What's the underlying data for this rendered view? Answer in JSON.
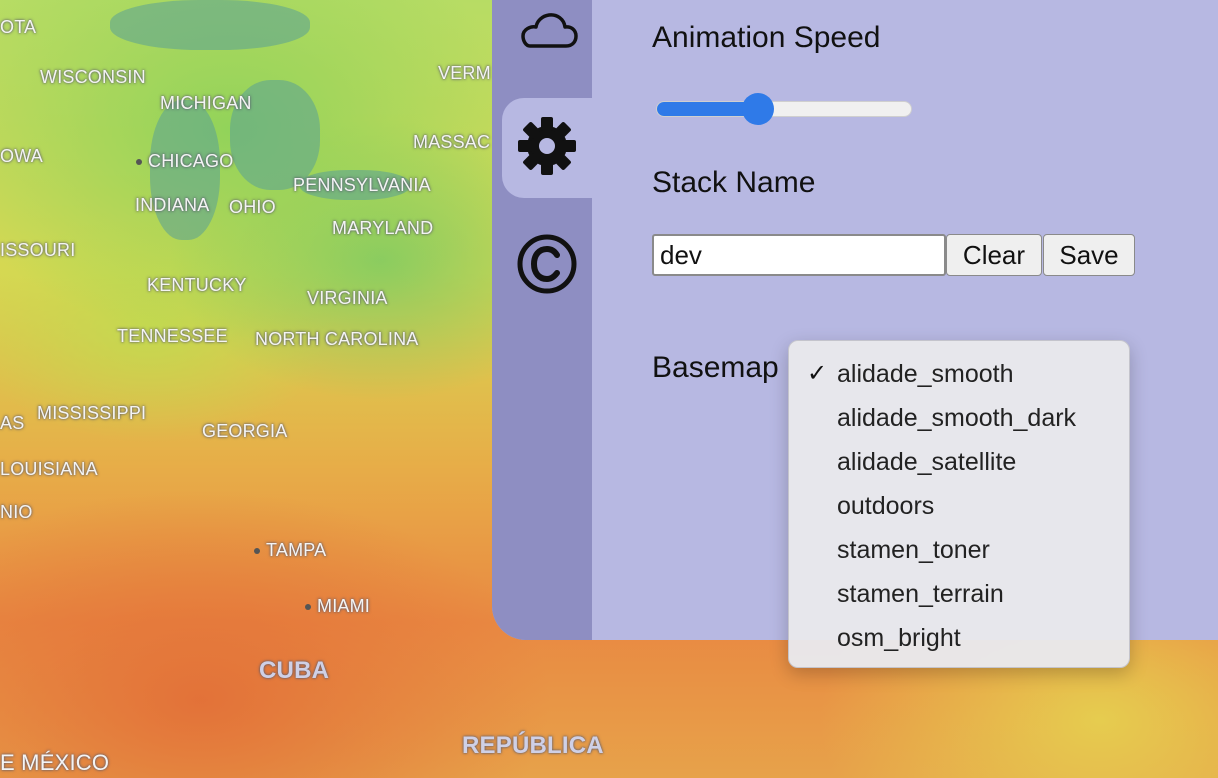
{
  "map": {
    "labels": [
      {
        "text": "OTA",
        "type": "region"
      },
      {
        "text": "WISCONSIN",
        "type": "region"
      },
      {
        "text": "VERM",
        "type": "region"
      },
      {
        "text": "MICHIGAN",
        "type": "region"
      },
      {
        "text": "OWA",
        "type": "region"
      },
      {
        "text": "CHICAGO",
        "type": "city"
      },
      {
        "text": "MASSAC",
        "type": "region"
      },
      {
        "text": "PENNSYLVANIA",
        "type": "region"
      },
      {
        "text": "INDIANA",
        "type": "region"
      },
      {
        "text": "OHIO",
        "type": "region"
      },
      {
        "text": "MARYLAND",
        "type": "region"
      },
      {
        "text": "ISSOURI",
        "type": "region"
      },
      {
        "text": "KENTUCKY",
        "type": "region"
      },
      {
        "text": "VIRGINIA",
        "type": "region"
      },
      {
        "text": "TENNESSEE",
        "type": "region"
      },
      {
        "text": "NORTH CAROLINA",
        "type": "region"
      },
      {
        "text": "AS",
        "type": "region"
      },
      {
        "text": "MISSISSIPPI",
        "type": "region"
      },
      {
        "text": "GEORGIA",
        "type": "region"
      },
      {
        "text": "LOUISIANA",
        "type": "region"
      },
      {
        "text": "NIO",
        "type": "region"
      },
      {
        "text": "TAMPA",
        "type": "city"
      },
      {
        "text": "MIAMI",
        "type": "city"
      },
      {
        "text": "CUBA",
        "type": "country"
      },
      {
        "text": "REPÚBLICA",
        "type": "country"
      },
      {
        "text": "E MÉXICO",
        "type": "region"
      }
    ]
  },
  "sidebar": {
    "tabs": [
      {
        "icon": "cloud-icon",
        "active": false
      },
      {
        "icon": "gear-icon",
        "active": true
      },
      {
        "icon": "copyright-icon",
        "active": false
      }
    ]
  },
  "settings": {
    "animation_speed_label": "Animation Speed",
    "animation_speed_value": 0.4,
    "stack_name_label": "Stack Name",
    "stack_name_value": "dev",
    "clear_label": "Clear",
    "save_label": "Save",
    "basemap_label": "Basemap"
  },
  "basemap_dropdown": {
    "selected": "alidade_smooth",
    "options": [
      "alidade_smooth",
      "alidade_smooth_dark",
      "alidade_satellite",
      "outdoors",
      "stamen_toner",
      "stamen_terrain",
      "osm_bright"
    ]
  },
  "colors": {
    "panel": "#b7b8e2",
    "rail": "#8e8ec2",
    "accent": "#2f7ae8"
  }
}
